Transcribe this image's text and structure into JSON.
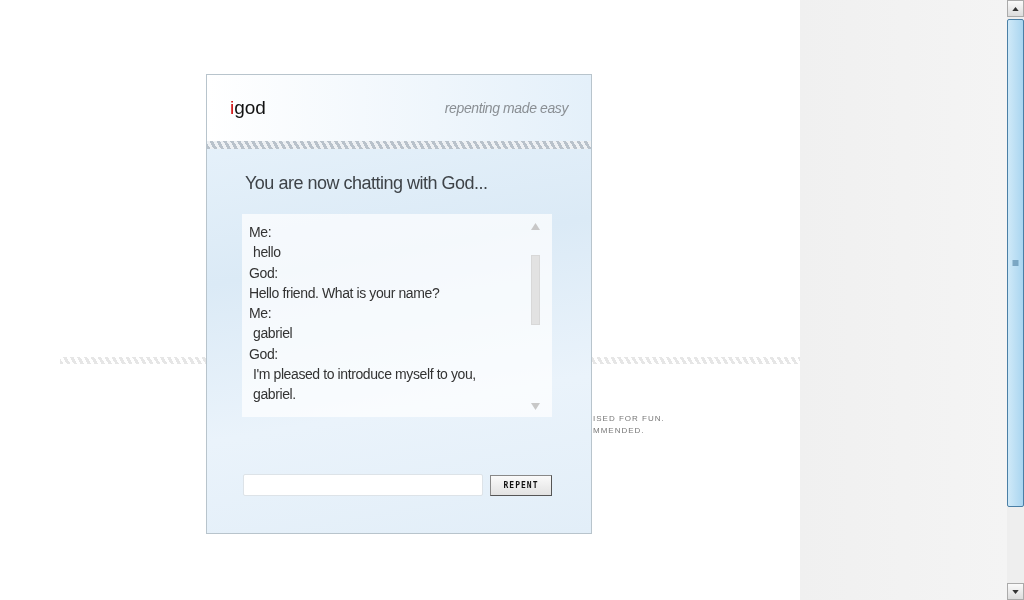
{
  "background": {
    "notice_lines": [
      "ISED FOR FUN.",
      "MMENDED."
    ]
  },
  "dialog": {
    "logo": {
      "accent": "i",
      "rest": "god"
    },
    "tagline": "repenting made easy",
    "heading": "You are now chatting with God...",
    "log": [
      {
        "kind": "speaker",
        "text": "Me:"
      },
      {
        "kind": "message",
        "text": "hello"
      },
      {
        "kind": "speaker",
        "text": "God:"
      },
      {
        "kind": "speaker",
        "text": "Hello friend. What is your name?"
      },
      {
        "kind": "speaker",
        "text": "Me:"
      },
      {
        "kind": "message",
        "text": "gabriel"
      },
      {
        "kind": "speaker",
        "text": "God:"
      },
      {
        "kind": "message",
        "text": "I'm pleased to introduce myself to you, gabriel."
      }
    ],
    "button": "REPENT"
  }
}
